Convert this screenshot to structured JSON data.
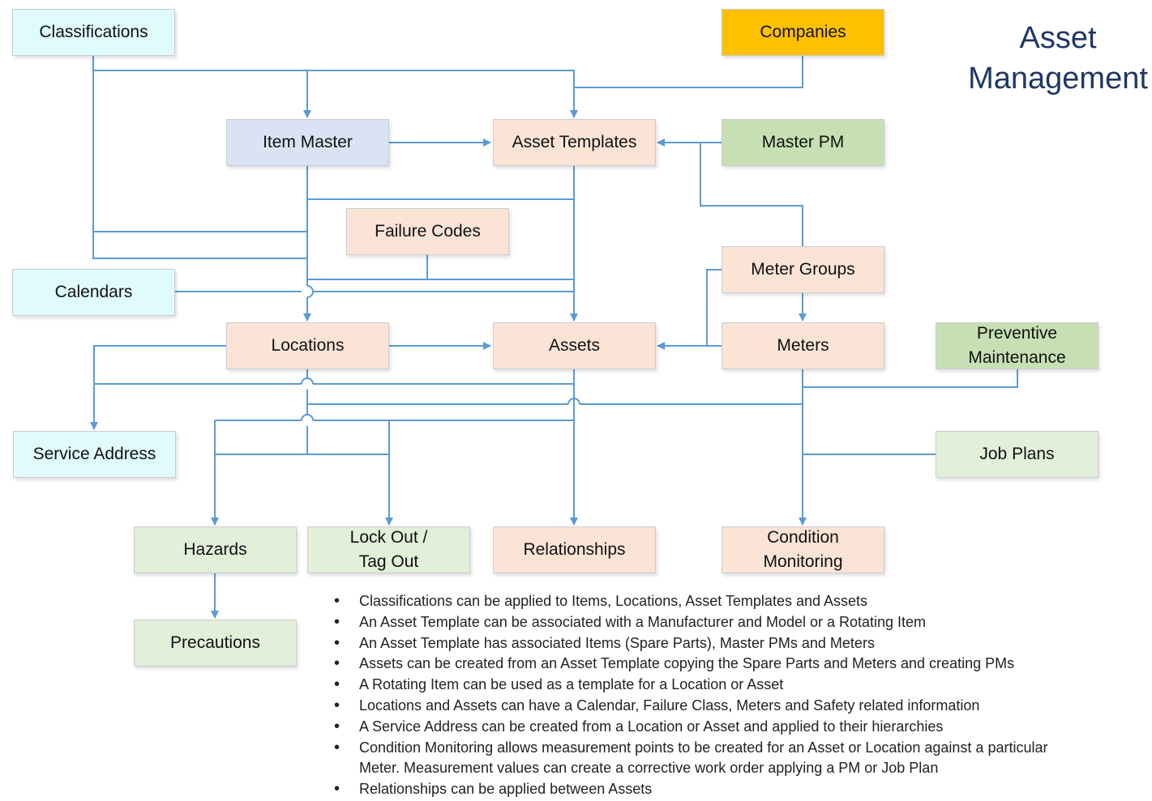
{
  "title": {
    "line1": "Asset",
    "line2": "Management"
  },
  "colors": {
    "connector": "#5b9bd5",
    "title": "#1f3864",
    "cyan_fill": "#e0fbfd",
    "blue_fill": "#dae3f3",
    "peach_fill": "#fbe4d6",
    "green_fill": "#c6e0b4",
    "light_green_fill": "#e2efd9",
    "gold_fill": "#ffc000"
  },
  "nodes": {
    "classifications": "Classifications",
    "companies": "Companies",
    "item_master": "Item Master",
    "asset_templates": "Asset Templates",
    "master_pm": "Master PM",
    "failure_codes": "Failure Codes",
    "meter_groups": "Meter Groups",
    "calendars": "Calendars",
    "locations": "Locations",
    "assets": "Assets",
    "meters": "Meters",
    "preventive_maintenance": [
      "Preventive",
      "Maintenance"
    ],
    "service_address": "Service Address",
    "job_plans": "Job Plans",
    "hazards": "Hazards",
    "lock_out_tag_out": [
      "Lock Out /",
      "Tag Out"
    ],
    "relationships": "Relationships",
    "condition_monitoring": [
      "Condition",
      "Monitoring"
    ],
    "precautions": "Precautions"
  },
  "notes": [
    "Classifications can be applied to Items, Locations, Asset Templates and Assets",
    "An Asset Template can be associated with a Manufacturer and Model or a Rotating Item",
    "An Asset Template has associated Items (Spare Parts), Master PMs and Meters",
    "Assets can be created from an Asset Template copying the Spare Parts and Meters and creating PMs",
    "A Rotating Item can be used as a template for a Location or Asset",
    "Locations and Assets can have a Calendar, Failure Class, Meters and Safety related information",
    "A Service Address can be created from a Location or Asset and applied to their hierarchies",
    "Condition Monitoring allows measurement points to be created for an Asset or Location against a particular",
    "Meter. Measurement values can create a corrective work order applying a PM or Job Plan",
    "Relationships can be applied between Assets"
  ]
}
